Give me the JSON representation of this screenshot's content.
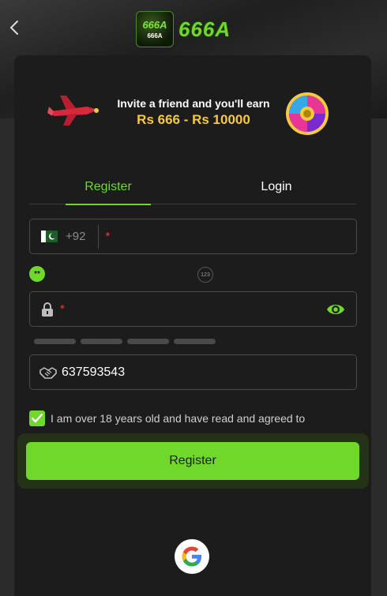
{
  "app": {
    "logo_text": "666A",
    "logo_badge_text": "666A",
    "logo_badge_sub": "666A"
  },
  "banner": {
    "line1": "Invite a friend and you'll earn",
    "line2": "Rs 666 - Rs 10000"
  },
  "tabs": [
    {
      "label": "Register",
      "active": true
    },
    {
      "label": "Login",
      "active": false
    }
  ],
  "phone": {
    "country_code": "+92",
    "required_marker": "*",
    "value": ""
  },
  "password_rules": {
    "badge": "**",
    "numeric_badge": "123"
  },
  "password": {
    "required_marker": "*",
    "value": "",
    "strength_bars": 4
  },
  "invite": {
    "value": "637593543"
  },
  "agreement": {
    "checked": true,
    "text": "I am over 18 years old and have read and agreed to"
  },
  "register_button": {
    "label": "Register"
  },
  "colors": {
    "accent": "#6fd82a",
    "card": "#1c1c1c",
    "background": "#2b2b2b",
    "gold": "#f6c940"
  },
  "icons": [
    "chevron-left-icon",
    "pakistan-flag-icon",
    "lock-icon",
    "eye-icon",
    "handshake-icon",
    "check-icon",
    "google-icon"
  ]
}
